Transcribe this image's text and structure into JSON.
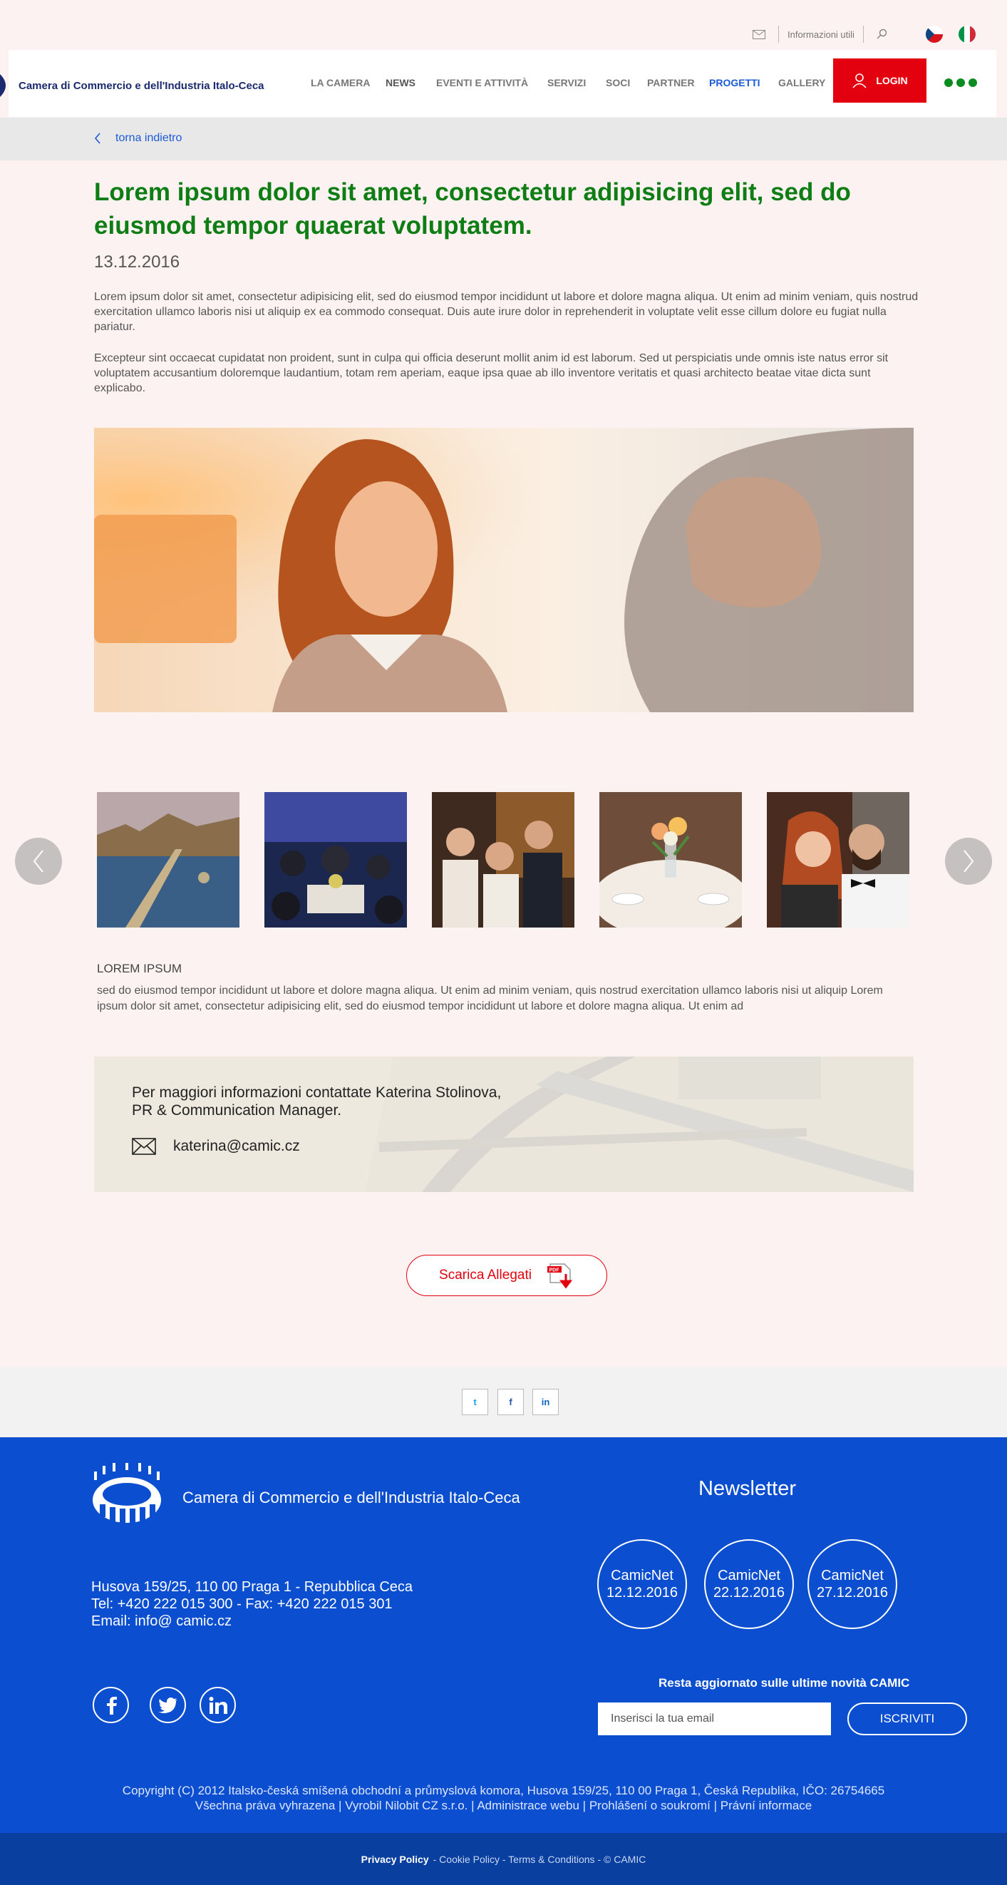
{
  "util": {
    "info_label": "Informazioni utili"
  },
  "header": {
    "logo_text": "Camera di Commercio e dell'Industria Italo-Ceca",
    "nav": [
      "LA CAMERA",
      "NEWS",
      "EVENTI E ATTIVITÀ",
      "SERVIZI",
      "SOCI",
      "PARTNER",
      "PROGETTI",
      "GALLERY"
    ],
    "active_nav": "PROGETTI",
    "login_label": "LOGIN"
  },
  "breadcrumb": {
    "back_label": "torna indietro"
  },
  "article": {
    "title": "Lorem ipsum dolor sit amet, consectetur adipisicing elit, sed do eiusmod tempor quaerat voluptatem.",
    "date": "13.12.2016",
    "paragraph1": "Lorem ipsum dolor sit amet, consectetur adipisicing elit, sed do eiusmod tempor incididunt ut labore et dolore magna aliqua. Ut enim ad minim veniam, quis nostrud exercitation ullamco laboris nisi ut aliquip ex ea commodo consequat. Duis aute irure dolor in reprehenderit in voluptate velit esse cillum dolore eu fugiat nulla pariatur.",
    "paragraph2": "Excepteur sint occaecat cupidatat non proident, sunt in culpa qui officia deserunt mollit anim id est laborum. Sed ut perspiciatis unde omnis iste natus error sit voluptatem accusantium doloremque laudantium, totam rem aperiam, eaque ipsa quae ab illo inventore veritatis et quasi architecto beatae vitae dicta sunt explicabo."
  },
  "gallery": {
    "caption_title": "LOREM IPSUM",
    "caption_text": "sed do eiusmod tempor incididunt ut labore et dolore magna aliqua. Ut enim ad minim veniam, quis nostrud exercitation ullamco laboris nisi ut aliquip Lorem ipsum dolor sit amet, consectetur adipisicing elit, sed do eiusmod tempor incididunt ut labore et dolore magna aliqua. Ut enim ad"
  },
  "contact": {
    "text_line1": "Per maggiori informazioni contattate Katerina Stolinova,",
    "text_line2": "PR & Communication Manager.",
    "email": "katerina@camic.cz"
  },
  "download": {
    "label": "Scarica Allegati",
    "badge": "PDF"
  },
  "share": {
    "twitter": "t",
    "facebook": "f",
    "linkedin": "in"
  },
  "footer": {
    "name": "Camera di Commercio e dell'Industria Italo-Ceca",
    "address_line1": "Husova 159/25, 110 00 Praga 1 - Repubblica Ceca",
    "address_line2": "Tel: +420 222 015 300 - Fax: +420 222 015 301",
    "address_line3": "Email: info@ camic.cz",
    "newsletter_title": "Newsletter",
    "newsletters": [
      {
        "name": "CamicNet",
        "date": "12.12.2016"
      },
      {
        "name": "CamicNet",
        "date": "22.12.2016"
      },
      {
        "name": "CamicNet",
        "date": "27.12.2016"
      }
    ],
    "cta": "Resta aggiornato sulle ultime novità CAMIC",
    "email_placeholder": "Inserisci la tua email",
    "subscribe_label": "ISCRIVITI",
    "copyright1": "Copyright (C) 2012 Italsko-česká smíšená obchodní a průmyslová komora, Husova 159/25, 110 00 Praga 1, Česká Republika, IČO: 26754665",
    "copyright2": "Všechna práva vyhrazena | Vyrobil Nilobit CZ s.r.o. | Administrace webu | Prohlášení o soukromí | Právní informace"
  },
  "bottombar": {
    "privacy": "Privacy Policy",
    "rest": "- Cookie Policy - Terms & Conditions - © CAMIC"
  },
  "colors": {
    "brand_blue": "#0b4fd0",
    "accent_red": "#e3000f",
    "title_green": "#0e7d13",
    "nav_active": "#1a5ad7"
  }
}
